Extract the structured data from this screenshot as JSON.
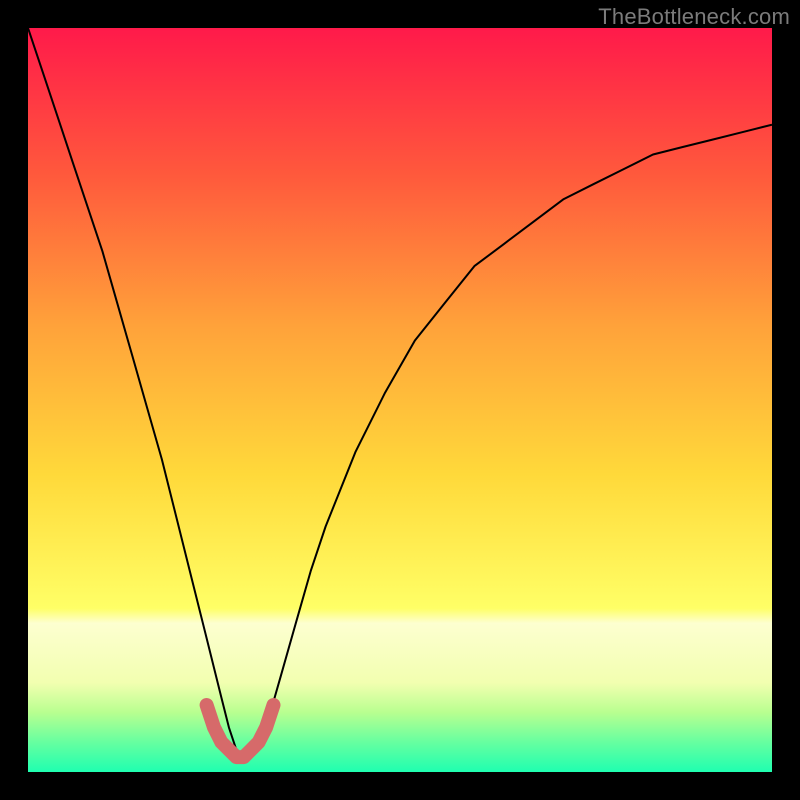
{
  "watermark": "TheBottleneck.com",
  "chart_data": {
    "type": "line",
    "title": "",
    "xlabel": "",
    "ylabel": "",
    "xlim": [
      0,
      100
    ],
    "ylim": [
      0,
      100
    ],
    "grid": false,
    "legend": false,
    "background_gradient": {
      "stops": [
        {
          "offset": 0.0,
          "color": "#ff1a4a"
        },
        {
          "offset": 0.2,
          "color": "#ff5a3c"
        },
        {
          "offset": 0.4,
          "color": "#ffa23a"
        },
        {
          "offset": 0.6,
          "color": "#ffd93a"
        },
        {
          "offset": 0.78,
          "color": "#ffff66"
        },
        {
          "offset": 0.8,
          "color": "#fdffd0"
        },
        {
          "offset": 0.88,
          "color": "#f2ffb0"
        },
        {
          "offset": 0.92,
          "color": "#b8ff90"
        },
        {
          "offset": 0.96,
          "color": "#66ffa0"
        },
        {
          "offset": 1.0,
          "color": "#1fffb0"
        }
      ]
    },
    "series": [
      {
        "name": "bottleneck-curve",
        "color": "#000000",
        "stroke_width": 2,
        "x": [
          0,
          2,
          4,
          6,
          8,
          10,
          12,
          14,
          16,
          18,
          20,
          22,
          24,
          26,
          27,
          28,
          29,
          30,
          31,
          32,
          34,
          36,
          38,
          40,
          44,
          48,
          52,
          56,
          60,
          64,
          68,
          72,
          76,
          80,
          84,
          88,
          92,
          96,
          100
        ],
        "y": [
          100,
          94,
          88,
          82,
          76,
          70,
          63,
          56,
          49,
          42,
          34,
          26,
          18,
          10,
          6,
          3,
          2,
          2,
          3,
          6,
          13,
          20,
          27,
          33,
          43,
          51,
          58,
          63,
          68,
          71,
          74,
          77,
          79,
          81,
          83,
          84,
          85,
          86,
          87
        ]
      },
      {
        "name": "optimal-zone-highlight",
        "color": "#d66a6a",
        "stroke_width": 14,
        "linecap": "round",
        "x": [
          24,
          25,
          26,
          27,
          28,
          29,
          30,
          31,
          32,
          33
        ],
        "y": [
          9,
          6,
          4,
          3,
          2,
          2,
          3,
          4,
          6,
          9
        ]
      }
    ]
  }
}
